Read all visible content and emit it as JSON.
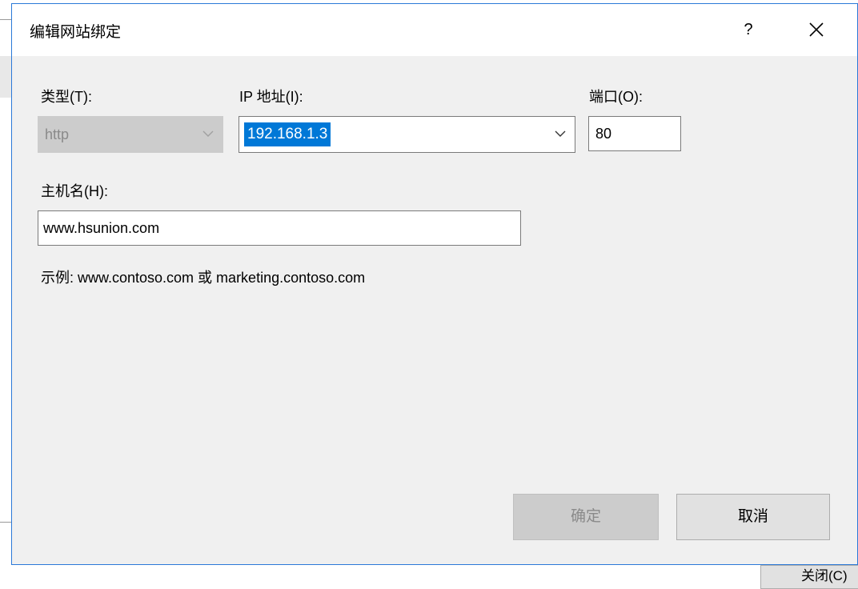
{
  "dialog": {
    "title": "编辑网站绑定",
    "help_label": "?",
    "type": {
      "label": "类型(T):",
      "value": "http"
    },
    "ip": {
      "label": "IP 地址(I):",
      "value": "192.168.1.3"
    },
    "port": {
      "label": "端口(O):",
      "value": "80"
    },
    "host": {
      "label": "主机名(H):",
      "value": "www.hsunion.com"
    },
    "example_text": "示例: www.contoso.com 或 marketing.contoso.com",
    "ok_label": "确定",
    "cancel_label": "取消"
  },
  "background": {
    "close_button_label": "关闭(C)"
  },
  "colors": {
    "accent": "#0078d7",
    "dialog_border": "#2b79d8",
    "dialog_bg": "#f0f0f0",
    "disabled_bg": "#cccccc"
  },
  "icons": {
    "close": "close-icon",
    "dropdown": "chevron-down-icon"
  }
}
